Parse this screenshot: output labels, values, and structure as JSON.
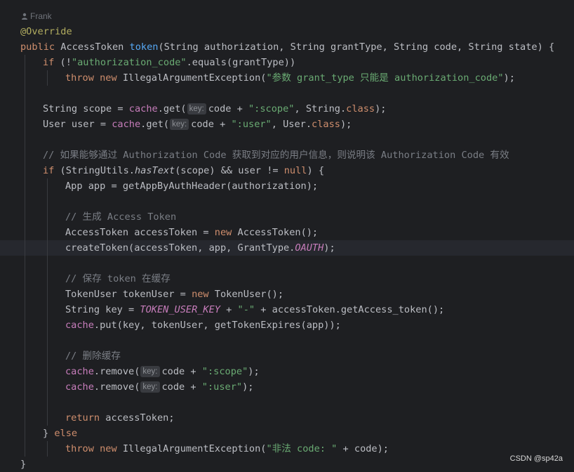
{
  "author": {
    "name": "Frank",
    "icon": "user-icon"
  },
  "lines": [
    {
      "indent": 0,
      "tokens": [
        {
          "t": "@Override",
          "c": "ann"
        }
      ]
    },
    {
      "indent": 0,
      "tokens": [
        {
          "t": "public",
          "c": "kw"
        },
        {
          "t": " AccessToken "
        },
        {
          "t": "token",
          "c": "fn"
        },
        {
          "t": "(String authorization, String grantType, String code, String state) {"
        }
      ]
    },
    {
      "indent": 1,
      "tokens": [
        {
          "t": "if",
          "c": "kw"
        },
        {
          "t": " (!"
        },
        {
          "t": "\"authorization_code\"",
          "c": "str"
        },
        {
          "t": ".equals(grantType))"
        }
      ]
    },
    {
      "indent": 2,
      "tokens": [
        {
          "t": "throw",
          "c": "kw"
        },
        {
          "t": " "
        },
        {
          "t": "new",
          "c": "kw"
        },
        {
          "t": " IllegalArgumentException("
        },
        {
          "t": "\"参数 grant_type 只能是 authorization_code\"",
          "c": "str"
        },
        {
          "t": ");"
        }
      ]
    },
    {
      "indent": 1,
      "tokens": []
    },
    {
      "indent": 1,
      "tokens": [
        {
          "t": "String scope = "
        },
        {
          "t": "cache",
          "c": "fld"
        },
        {
          "t": ".get("
        },
        {
          "t": "key:",
          "c": "hint"
        },
        {
          "t": "code + "
        },
        {
          "t": "\":scope\"",
          "c": "str"
        },
        {
          "t": ", String."
        },
        {
          "t": "class",
          "c": "kw"
        },
        {
          "t": ");"
        }
      ]
    },
    {
      "indent": 1,
      "tokens": [
        {
          "t": "User user = "
        },
        {
          "t": "cache",
          "c": "fld"
        },
        {
          "t": ".get("
        },
        {
          "t": "key:",
          "c": "hint"
        },
        {
          "t": "code + "
        },
        {
          "t": "\":user\"",
          "c": "str"
        },
        {
          "t": ", User."
        },
        {
          "t": "class",
          "c": "kw"
        },
        {
          "t": ");"
        }
      ]
    },
    {
      "indent": 1,
      "tokens": []
    },
    {
      "indent": 1,
      "tokens": [
        {
          "t": "// 如果能够通过 Authorization Code 获取到对应的用户信息，则说明该 Authorization Code 有效",
          "c": "cm"
        }
      ]
    },
    {
      "indent": 1,
      "tokens": [
        {
          "t": "if",
          "c": "kw"
        },
        {
          "t": " (StringUtils."
        },
        {
          "t": "hasText",
          "c": "it"
        },
        {
          "t": "(scope) && user != "
        },
        {
          "t": "null",
          "c": "kw"
        },
        {
          "t": ") {"
        }
      ]
    },
    {
      "indent": 2,
      "tokens": [
        {
          "t": "App app = getAppByAuthHeader(authorization);"
        }
      ]
    },
    {
      "indent": 2,
      "tokens": []
    },
    {
      "indent": 2,
      "tokens": [
        {
          "t": "// 生成 Access Token",
          "c": "cm"
        }
      ]
    },
    {
      "indent": 2,
      "tokens": [
        {
          "t": "AccessToken accessToken = "
        },
        {
          "t": "new",
          "c": "kw"
        },
        {
          "t": " AccessToken();"
        }
      ]
    },
    {
      "indent": 2,
      "current": true,
      "tokens": [
        {
          "t": "createToken(accessToken, app, GrantType."
        },
        {
          "t": "OAUTH",
          "c": "const"
        },
        {
          "t": ");"
        }
      ]
    },
    {
      "indent": 2,
      "tokens": []
    },
    {
      "indent": 2,
      "tokens": [
        {
          "t": "// 保存 token 在缓存",
          "c": "cm"
        }
      ]
    },
    {
      "indent": 2,
      "tokens": [
        {
          "t": "TokenUser tokenUser = "
        },
        {
          "t": "new",
          "c": "kw"
        },
        {
          "t": " TokenUser();"
        }
      ]
    },
    {
      "indent": 2,
      "tokens": [
        {
          "t": "String key = "
        },
        {
          "t": "TOKEN_USER_KEY",
          "c": "const"
        },
        {
          "t": " + "
        },
        {
          "t": "\"-\"",
          "c": "str"
        },
        {
          "t": " + accessToken.getAccess_token();"
        }
      ]
    },
    {
      "indent": 2,
      "tokens": [
        {
          "t": "cache",
          "c": "fld"
        },
        {
          "t": ".put(key, tokenUser, getTokenExpires(app));"
        }
      ]
    },
    {
      "indent": 2,
      "tokens": []
    },
    {
      "indent": 2,
      "tokens": [
        {
          "t": "// 删除缓存",
          "c": "cm"
        }
      ]
    },
    {
      "indent": 2,
      "tokens": [
        {
          "t": "cache",
          "c": "fld"
        },
        {
          "t": ".remove("
        },
        {
          "t": "key:",
          "c": "hint"
        },
        {
          "t": "code + "
        },
        {
          "t": "\":scope\"",
          "c": "str"
        },
        {
          "t": ");"
        }
      ]
    },
    {
      "indent": 2,
      "tokens": [
        {
          "t": "cache",
          "c": "fld"
        },
        {
          "t": ".remove("
        },
        {
          "t": "key:",
          "c": "hint"
        },
        {
          "t": "code + "
        },
        {
          "t": "\":user\"",
          "c": "str"
        },
        {
          "t": ");"
        }
      ]
    },
    {
      "indent": 2,
      "tokens": []
    },
    {
      "indent": 2,
      "tokens": [
        {
          "t": "return",
          "c": "kw"
        },
        {
          "t": " accessToken;"
        }
      ]
    },
    {
      "indent": 1,
      "tokens": [
        {
          "t": "} "
        },
        {
          "t": "else",
          "c": "kw"
        }
      ]
    },
    {
      "indent": 2,
      "tokens": [
        {
          "t": "throw",
          "c": "kw"
        },
        {
          "t": " "
        },
        {
          "t": "new",
          "c": "kw"
        },
        {
          "t": " IllegalArgumentException("
        },
        {
          "t": "\"非法 code: \"",
          "c": "str"
        },
        {
          "t": " + code);"
        }
      ]
    },
    {
      "indent": 0,
      "tokens": [
        {
          "t": "}"
        }
      ]
    }
  ],
  "watermark": "CSDN @sp42a",
  "colors": {
    "background": "#1e1f22",
    "keyword": "#cf8e6d",
    "annotation": "#b3ae60",
    "method": "#56a8f5",
    "string": "#6aab73",
    "field": "#c77dbb",
    "comment": "#7a7e85",
    "text": "#bcbec4"
  }
}
